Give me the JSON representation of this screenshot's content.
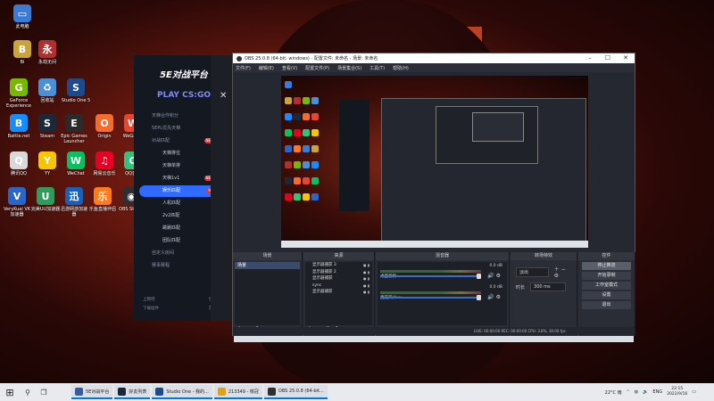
{
  "desktop_icons": [
    {
      "label": "此电脑",
      "color": "#3a7bd5",
      "glyph": "▭"
    },
    {
      "label": "Bi",
      "color": "#caa33a",
      "glyph": "B"
    },
    {
      "label": "永劫无间",
      "color": "#b03030",
      "glyph": "永"
    },
    {
      "label": "GeForce Experience",
      "color": "#76b900",
      "glyph": "G"
    },
    {
      "label": "回收站",
      "color": "#4a90d9",
      "glyph": "♻"
    },
    {
      "label": "Studio One 5",
      "color": "#1c4a8c",
      "glyph": "S"
    },
    {
      "label": "Battle.net",
      "color": "#148eff",
      "glyph": "B"
    },
    {
      "label": "Steam",
      "color": "#1b2838",
      "glyph": "S"
    },
    {
      "label": "Epic Games Launcher",
      "color": "#2a2a2a",
      "glyph": "E"
    },
    {
      "label": "Origin",
      "color": "#f56c2d",
      "glyph": "O"
    },
    {
      "label": "WeGame",
      "color": "#e8442e",
      "glyph": "W"
    },
    {
      "label": "腾讯QQ",
      "color": "#d9d9d9",
      "glyph": "Q"
    },
    {
      "label": "YY",
      "color": "#f7c600",
      "glyph": "Y"
    },
    {
      "label": "WeChat",
      "color": "#07c160",
      "glyph": "W"
    },
    {
      "label": "网易云音乐",
      "color": "#e60026",
      "glyph": "♫"
    },
    {
      "label": "QQ音乐",
      "color": "#31c27c",
      "glyph": "Q"
    },
    {
      "label": "VeryKuai VK加速器",
      "color": "#2a65c9",
      "glyph": "V"
    },
    {
      "label": "完美UU加速器",
      "color": "#2f9c5d",
      "glyph": "U"
    },
    {
      "label": "迅游网游加速器",
      "color": "#1560bd",
      "glyph": "迅"
    },
    {
      "label": "乐鱼直播伴侣",
      "color": "#ff7a1a",
      "glyph": "乐"
    },
    {
      "label": "OBS Studio",
      "color": "#302e31",
      "glyph": "◉"
    }
  ],
  "platform": {
    "logo": "5E对战平台",
    "play_label": "PLAY CS:GO",
    "menu": [
      {
        "label": "天梯合作积分",
        "sub": false,
        "active": false,
        "hot": ""
      },
      {
        "label": "5EPL优先天梯",
        "sub": false,
        "active": false,
        "hot": ""
      },
      {
        "label": "对战匹配",
        "sub": false,
        "active": false,
        "hot": "NEW"
      },
      {
        "label": "天梯排位",
        "sub": true,
        "active": false,
        "hot": ""
      },
      {
        "label": "天梯单排",
        "sub": true,
        "active": false,
        "hot": ""
      },
      {
        "label": "天梯1v1",
        "sub": true,
        "active": false,
        "hot": "NEW"
      },
      {
        "label": "娱乐匹配",
        "sub": true,
        "active": true,
        "hot": "hot"
      },
      {
        "label": "人机匹配",
        "sub": true,
        "active": false,
        "hot": ""
      },
      {
        "label": "2v2匹配",
        "sub": true,
        "active": false,
        "hot": ""
      },
      {
        "label": "跳跳匹配",
        "sub": true,
        "active": false,
        "hot": ""
      },
      {
        "label": "团队匹配",
        "sub": true,
        "active": false,
        "hot": ""
      },
      {
        "label": "自定义房间",
        "sub": false,
        "active": false,
        "hot": ""
      },
      {
        "label": "赛事赛程",
        "sub": false,
        "active": false,
        "hot": ""
      }
    ],
    "bottom_left": "上网吧",
    "bottom_right": "快速加入",
    "bottom_left2": "下载插件",
    "bottom_right2": "游戏设置"
  },
  "obs": {
    "title": "OBS 25.0.8 (64-bit, windows) - 配置文件: 未命名 - 场景: 未命名",
    "menu": [
      "文件(F)",
      "编辑(E)",
      "查看(V)",
      "配置文件(P)",
      "场景集合(S)",
      "工具(T)",
      "帮助(H)"
    ],
    "docks": {
      "scenes_title": "场景",
      "sources_title": "来源",
      "mixer_title": "混音器",
      "transitions_title": "转场特效",
      "controls_title": "控件"
    },
    "scene_items": [
      "场景"
    ],
    "source_items": [
      "显示器捕获 3",
      "显示器捕获 2",
      "显示器捕获",
      "sync",
      "显示器捕获"
    ],
    "mixer": [
      {
        "name": "桌面音频",
        "db": "0.0 dB"
      },
      {
        "name": "麦克风/Aux",
        "db": "0.0 dB"
      }
    ],
    "transition": {
      "type": "淡出",
      "duration_label": "时长",
      "duration": "300 ms"
    },
    "controls": [
      "停止推流",
      "开始录制",
      "工作室模式",
      "设置",
      "退出"
    ],
    "status": "LIVE: 00:00:00   REC: 00:00:00   CPU: 3.8%, 30.00 fps"
  },
  "taskbar": {
    "apps": [
      {
        "label": "5E对战平台",
        "color": "#3a5ba0"
      },
      {
        "label": "好友列表",
        "color": "#1b2838"
      },
      {
        "label": "Studio One - 我的...",
        "color": "#1c4a8c"
      },
      {
        "label": "213349 - 核冠",
        "color": "#e0a21a"
      },
      {
        "label": "OBS 25.0.8 (64-bit...",
        "color": "#302e31"
      }
    ],
    "weather": "22°C 雨",
    "lang": "ENG",
    "time": "22:15",
    "date": "2022/9/16"
  }
}
